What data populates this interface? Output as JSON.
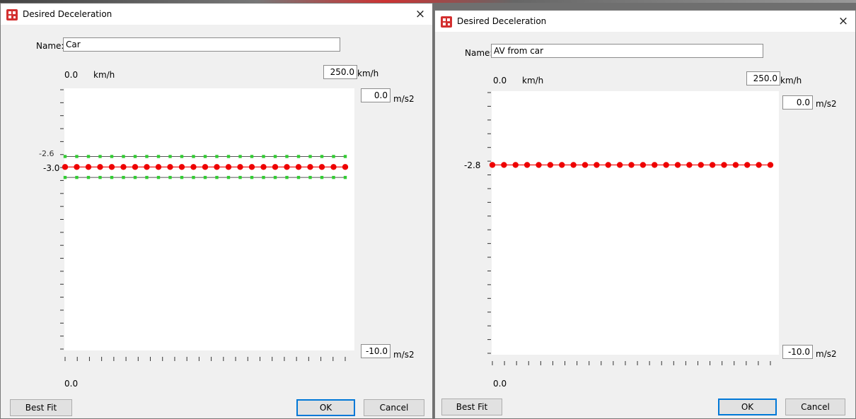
{
  "colors": {
    "point_red": "#ee0000",
    "point_green": "#33cc33",
    "axis_line": "#555555",
    "accent_blue": "#0078d7"
  },
  "icons": {
    "app": "app-icon-red",
    "close": "close-icon"
  },
  "dialogs": [
    {
      "title": "Desired Deceleration",
      "close_glyph": "×",
      "name_label": "Name:",
      "name_value": "Car",
      "x_min_label": "0.0",
      "x_unit_top": "km/h",
      "x_max_value": "250.0",
      "x_max_unit": "km/h",
      "y_max_value": "0.0",
      "y_max_unit": "m/s2",
      "y_min_value": "-10.0",
      "y_min_unit": "m/s2",
      "y_label_main": "-3.0",
      "y_label_upper": "-2.6",
      "x_bottom_label": "0.0",
      "buttons": {
        "best_fit": "Best Fit",
        "ok": "OK",
        "cancel": "Cancel"
      }
    },
    {
      "title": "Desired Deceleration",
      "close_glyph": "×",
      "name_label": "Name:",
      "name_value": "AV from car",
      "x_min_label": "0.0",
      "x_unit_top": "km/h",
      "x_max_value": "250.0",
      "x_max_unit": "km/h",
      "y_max_value": "0.0",
      "y_max_unit": "m/s2",
      "y_min_value": "-10.0",
      "y_min_unit": "m/s2",
      "y_label_main": "-2.8",
      "x_bottom_label": "0.0",
      "buttons": {
        "best_fit": "Best Fit",
        "ok": "OK",
        "cancel": "Cancel"
      }
    }
  ],
  "chart_data": [
    {
      "type": "line",
      "xlim": [
        0,
        250
      ],
      "ylim": [
        -10,
        0
      ],
      "x": [
        0,
        10,
        20,
        30,
        40,
        50,
        60,
        70,
        80,
        90,
        100,
        110,
        120,
        130,
        140,
        150,
        160,
        170,
        180,
        190,
        200,
        210,
        220,
        230,
        240
      ],
      "series": [
        {
          "role": "mean",
          "color": "#ee0000",
          "values": [
            -3.0,
            -3.0,
            -3.0,
            -3.0,
            -3.0,
            -3.0,
            -3.0,
            -3.0,
            -3.0,
            -3.0,
            -3.0,
            -3.0,
            -3.0,
            -3.0,
            -3.0,
            -3.0,
            -3.0,
            -3.0,
            -3.0,
            -3.0,
            -3.0,
            -3.0,
            -3.0,
            -3.0,
            -3.0
          ]
        },
        {
          "role": "upper-bound",
          "color": "#33cc33",
          "values": [
            -2.6,
            -2.6,
            -2.6,
            -2.6,
            -2.6,
            -2.6,
            -2.6,
            -2.6,
            -2.6,
            -2.6,
            -2.6,
            -2.6,
            -2.6,
            -2.6,
            -2.6,
            -2.6,
            -2.6,
            -2.6,
            -2.6,
            -2.6,
            -2.6,
            -2.6,
            -2.6,
            -2.6,
            -2.6
          ]
        },
        {
          "role": "lower-bound",
          "color": "#33cc33",
          "values": [
            -3.4,
            -3.4,
            -3.4,
            -3.4,
            -3.4,
            -3.4,
            -3.4,
            -3.4,
            -3.4,
            -3.4,
            -3.4,
            -3.4,
            -3.4,
            -3.4,
            -3.4,
            -3.4,
            -3.4,
            -3.4,
            -3.4,
            -3.4,
            -3.4,
            -3.4,
            -3.4,
            -3.4,
            -3.4
          ]
        }
      ]
    },
    {
      "type": "line",
      "xlim": [
        0,
        250
      ],
      "ylim": [
        -10,
        0
      ],
      "x": [
        0,
        10,
        20,
        30,
        40,
        50,
        60,
        70,
        80,
        90,
        100,
        110,
        120,
        130,
        140,
        150,
        160,
        170,
        180,
        190,
        200,
        210,
        220,
        230,
        240
      ],
      "series": [
        {
          "role": "mean",
          "color": "#ee0000",
          "values": [
            -2.8,
            -2.8,
            -2.8,
            -2.8,
            -2.8,
            -2.8,
            -2.8,
            -2.8,
            -2.8,
            -2.8,
            -2.8,
            -2.8,
            -2.8,
            -2.8,
            -2.8,
            -2.8,
            -2.8,
            -2.8,
            -2.8,
            -2.8,
            -2.8,
            -2.8,
            -2.8,
            -2.8,
            -2.8
          ]
        }
      ]
    }
  ]
}
